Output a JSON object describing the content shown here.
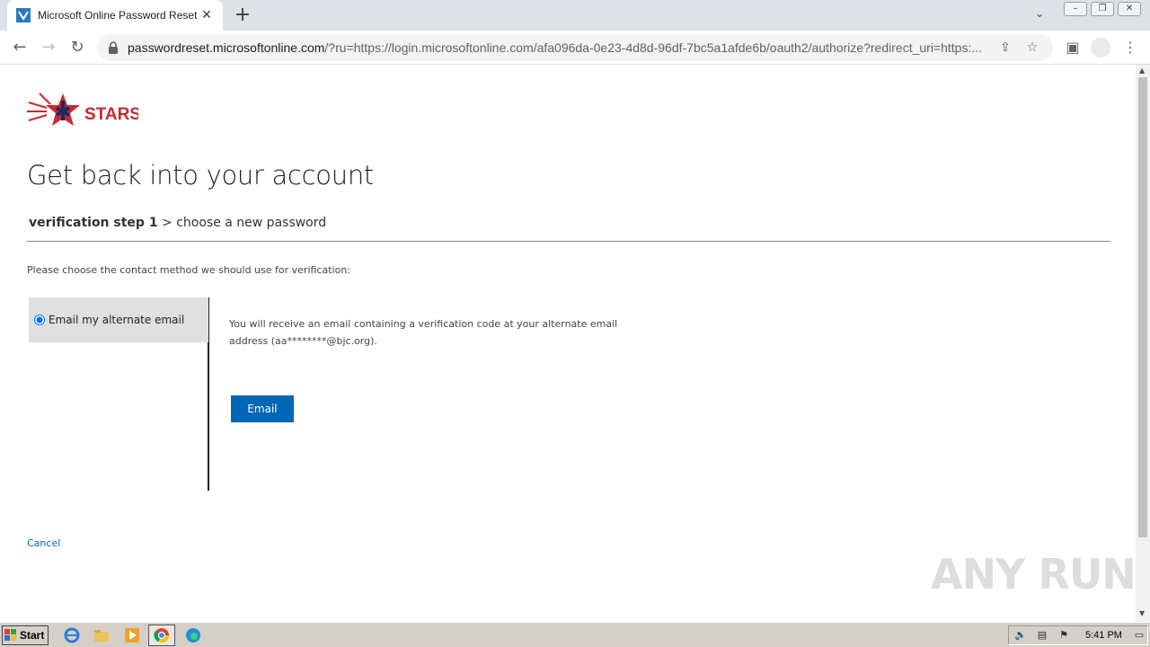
{
  "browser": {
    "tab_title": "Microsoft Online Password Reset",
    "tab_close": "✕",
    "new_tab": "+",
    "url_host": "passwordreset.microsoftonline.com",
    "url_path": "/?ru=https://login.microsoftonline.com/afa096da-0e23-4d8d-96df-7bc5a1afde6b/oauth2/authorize?redirect_uri=https:..."
  },
  "page": {
    "brand": "STARS",
    "heading": "Get back into your account",
    "step_current": "verification step 1",
    "step_separator": ">",
    "step_next": "choose a new password",
    "prompt": "Please choose the contact method we should use for verification:",
    "method_label": "Email my alternate email",
    "method_description": "You will receive an email containing a verification code at your alternate email address (aa********@bjc.org).",
    "email_button": "Email",
    "cancel_link": "Cancel",
    "watermark": "ANY RUN"
  },
  "taskbar": {
    "start_label": "Start",
    "clock": "5:41 PM"
  },
  "colors": {
    "accent": "#0067b8",
    "brand_red": "#c8282e",
    "brand_navy": "#1b2a5c"
  }
}
